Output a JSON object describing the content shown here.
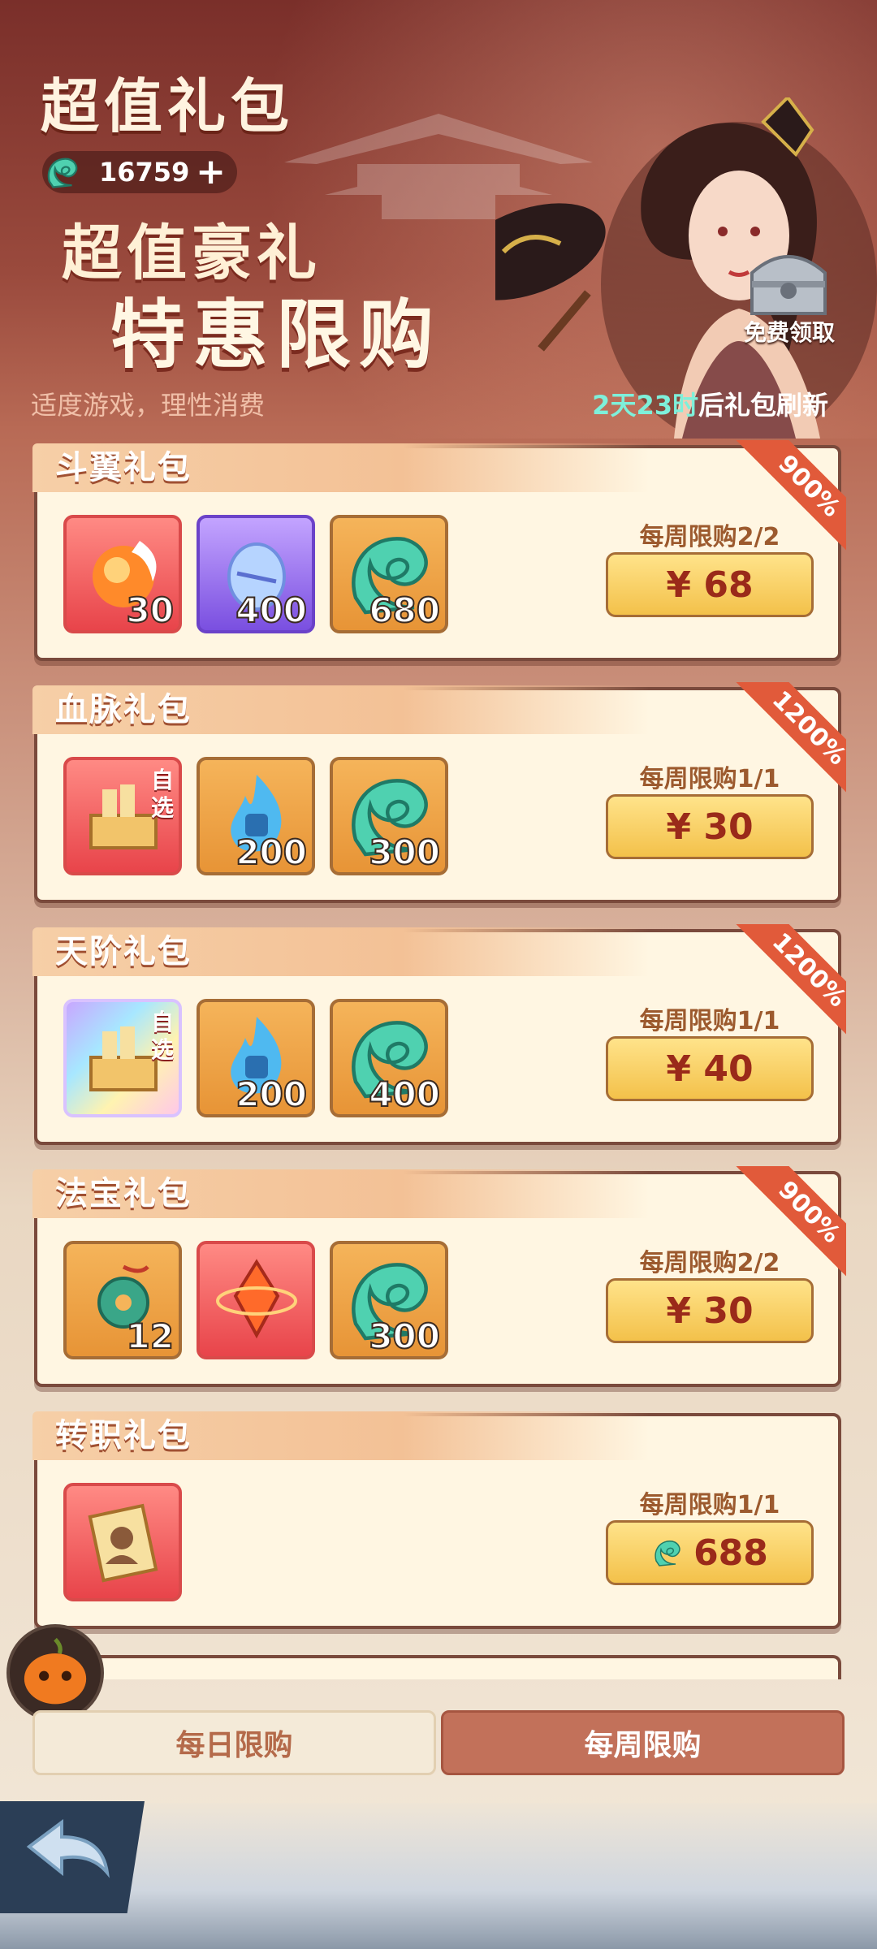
{
  "header": {
    "title": "超值礼包",
    "currency_amount": "16759",
    "currency_icon": "jade-swirl-icon",
    "slogan_line1": "超值豪礼",
    "slogan_line2": "特惠限购",
    "notice": "适度游戏，理性消费",
    "refresh_highlight": "2天23时",
    "refresh_suffix": "后礼包刷新",
    "free_claim_label": "免费领取"
  },
  "packages": [
    {
      "name": "斗翼礼包",
      "badge": "900%",
      "limit": "每周限购2/2",
      "price": "¥ 68",
      "price_type": "cash",
      "items": [
        {
          "icon": "flame-orb-icon",
          "qty": "30"
        },
        {
          "icon": "crystal-egg-icon",
          "qty": "400"
        },
        {
          "icon": "jade-swirl-icon",
          "qty": "680"
        }
      ]
    },
    {
      "name": "血脉礼包",
      "badge": "1200%",
      "limit": "每周限购1/1",
      "price": "¥ 30",
      "price_type": "cash",
      "items": [
        {
          "icon": "selectable-chest-icon",
          "qty": "",
          "self_select": "自选"
        },
        {
          "icon": "blue-flame-icon",
          "qty": "200"
        },
        {
          "icon": "jade-swirl-icon",
          "qty": "300"
        }
      ]
    },
    {
      "name": "天阶礼包",
      "badge": "1200%",
      "limit": "每周限购1/1",
      "price": "¥ 40",
      "price_type": "cash",
      "items": [
        {
          "icon": "selectable-chest-icon",
          "qty": "",
          "self_select": "自选"
        },
        {
          "icon": "blue-flame-icon",
          "qty": "200"
        },
        {
          "icon": "jade-swirl-icon",
          "qty": "400"
        }
      ]
    },
    {
      "name": "法宝礼包",
      "badge": "900%",
      "limit": "每周限购2/2",
      "price": "¥ 30",
      "price_type": "cash",
      "items": [
        {
          "icon": "jade-pendant-icon",
          "qty": "12"
        },
        {
          "icon": "fire-crystal-icon",
          "qty": ""
        },
        {
          "icon": "jade-swirl-icon",
          "qty": "300"
        }
      ]
    },
    {
      "name": "转职礼包",
      "badge": "",
      "limit": "每周限购1/1",
      "price": "688",
      "price_type": "currency",
      "items": [
        {
          "icon": "job-card-icon",
          "qty": ""
        }
      ]
    }
  ],
  "tabs": {
    "daily": "每日限购",
    "weekly": "每周限购",
    "active": "weekly"
  },
  "colors": {
    "accent": "#c2715a",
    "price_text": "#9a2a1a",
    "badge": "#e15a3a",
    "refresh_highlight": "#7ef0da"
  }
}
